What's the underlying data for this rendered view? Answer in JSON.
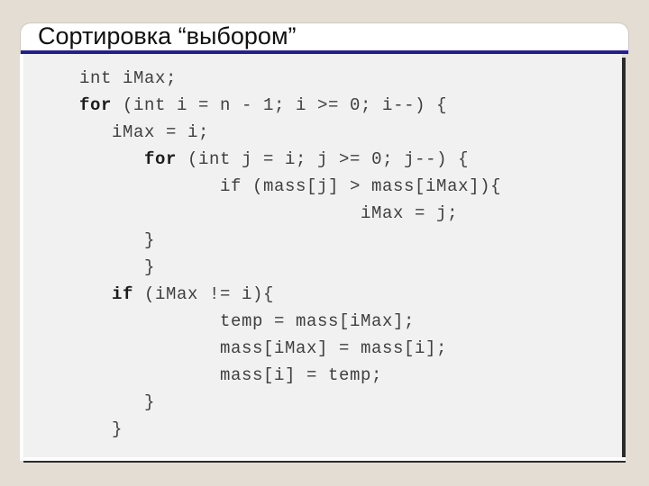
{
  "slide": {
    "title": "Сортировка “выбором”",
    "background_color": "#e3ddd3",
    "title_bar_color": "#ffffff",
    "accent_rule_color": "#231f8c",
    "code_panel_color": "#f1f1f1"
  },
  "code": {
    "language": "c-like",
    "lines": [
      {
        "indent": 0,
        "text": "int iMax;",
        "bold_prefix": ""
      },
      {
        "indent": 0,
        "text": "for (int i = n - 1; i >= 0; i--) {",
        "bold_prefix": "for"
      },
      {
        "indent": 3,
        "text": "iMax = i;",
        "bold_prefix": ""
      },
      {
        "indent": 6,
        "text": "for (int j = i; j >= 0; j--) {",
        "bold_prefix": "for"
      },
      {
        "indent": 13,
        "text": "if (mass[j] > mass[iMax]){",
        "bold_prefix": ""
      },
      {
        "indent": 26,
        "text": "iMax = j;",
        "bold_prefix": ""
      },
      {
        "indent": 6,
        "text": "}",
        "bold_prefix": ""
      },
      {
        "indent": 6,
        "text": "}",
        "bold_prefix": ""
      },
      {
        "indent": 3,
        "text": "if (iMax != i){",
        "bold_prefix": "if"
      },
      {
        "indent": 13,
        "text": "temp = mass[iMax];",
        "bold_prefix": ""
      },
      {
        "indent": 13,
        "text": "mass[iMax] = mass[i];",
        "bold_prefix": ""
      },
      {
        "indent": 13,
        "text": "mass[i] = temp;",
        "bold_prefix": ""
      },
      {
        "indent": 6,
        "text": "}",
        "bold_prefix": ""
      },
      {
        "indent": 3,
        "text": "}",
        "bold_prefix": ""
      }
    ]
  }
}
